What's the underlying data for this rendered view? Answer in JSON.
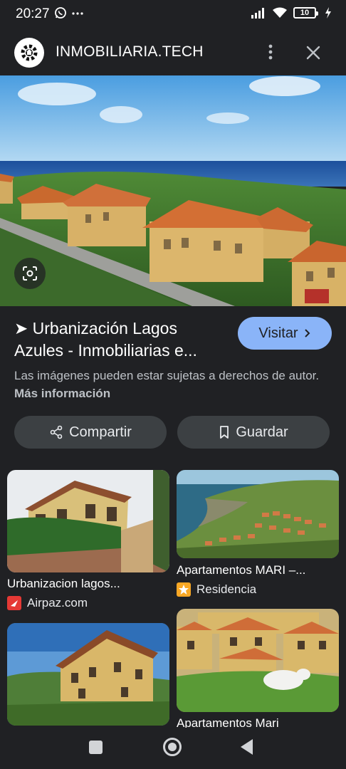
{
  "status_bar": {
    "time": "20:27",
    "battery": "10",
    "icons": [
      "whatsapp-icon",
      "more-dots-icon",
      "signal-icon",
      "wifi-icon",
      "battery-icon",
      "charging-icon"
    ]
  },
  "header": {
    "site_name": "INMOBILIARIA.TECH",
    "icons": [
      "site-logo-icon",
      "more-vert-icon",
      "close-icon"
    ]
  },
  "result": {
    "title": "➤ Urbanización Lagos Azules - Inmobiliarias e...",
    "visit_label": "Visitar",
    "disclaimer": "Las imágenes pueden estar sujetas a derechos de autor.",
    "more_info": "Más información",
    "share_label": "Compartir",
    "save_label": "Guardar"
  },
  "related": [
    {
      "title": "Urbanizacion lagos...",
      "source": "Airpaz.com",
      "favicon_color": "#e53935"
    },
    {
      "title": "Apartamentos MARI –...",
      "source": "Residencia",
      "favicon_color": "#f9a825"
    },
    {
      "title": "",
      "source": ""
    },
    {
      "title": "Apartamentos Mari",
      "source": ""
    }
  ],
  "colors": {
    "background": "#202124",
    "accent": "#8ab4f8",
    "button_bg": "#3c4043"
  }
}
